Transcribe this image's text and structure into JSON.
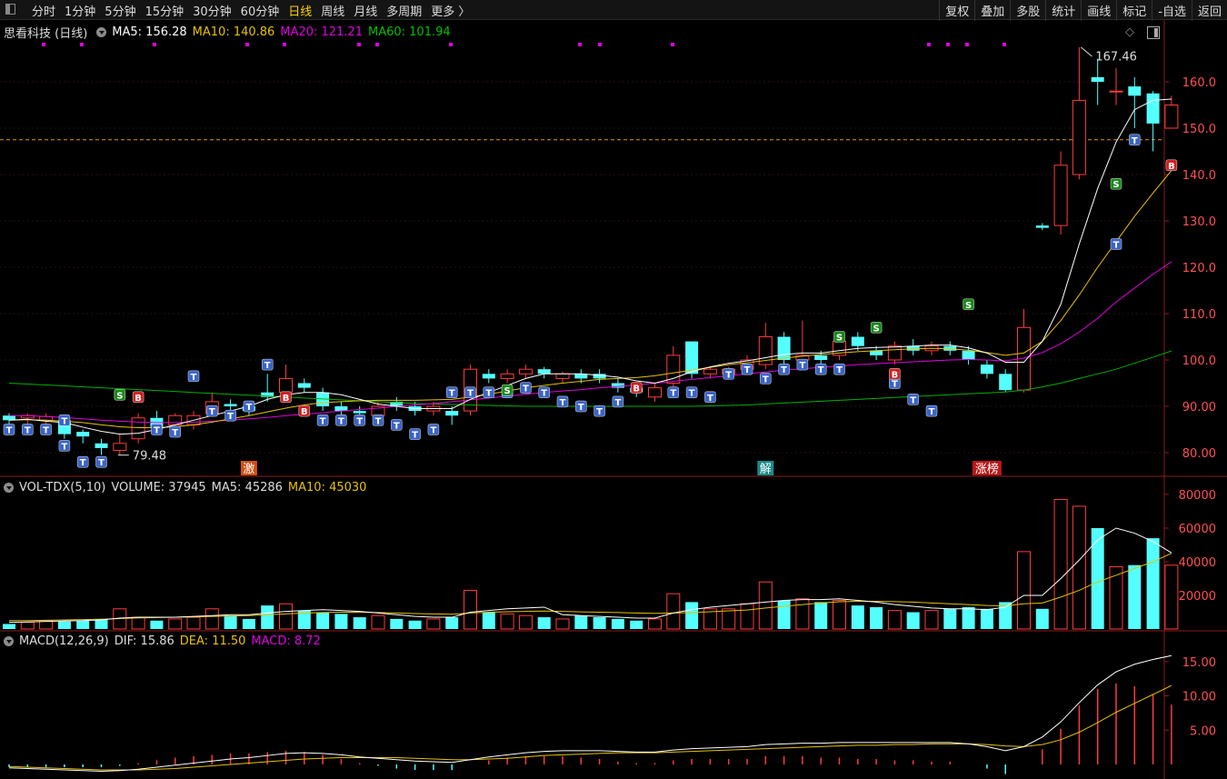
{
  "toolbar": {
    "periods": [
      "分时",
      "1分钟",
      "5分钟",
      "15分钟",
      "30分钟",
      "60分钟",
      "日线",
      "周线",
      "月线",
      "多周期",
      "更多 〉"
    ],
    "active_period": "日线",
    "tools": [
      "复权",
      "叠加",
      "多股",
      "统计",
      "画线",
      "标记",
      "-自选",
      "返回"
    ]
  },
  "price_panel": {
    "title": "思看科技 (日线)",
    "ma5": "MA5: 156.28",
    "ma10": "MA10: 140.86",
    "ma20": "MA20: 121.21",
    "ma60": "MA60: 101.94",
    "colors": {
      "ma5": "#ffffff",
      "ma10": "#e6c200",
      "ma20": "#e000e0",
      "ma60": "#00b000",
      "up": "#ff3b3b",
      "down": "#54ffff"
    },
    "high_label": "167.46",
    "low_label": "79.48",
    "current_price_line": 147.5,
    "event_labels": [
      "激",
      "解",
      "涨榜"
    ]
  },
  "volume_panel": {
    "name": "VOL-TDX(5,10)",
    "volume": "VOLUME: 37945",
    "ma5": "MA5: 45286",
    "ma10": "MA10: 45030",
    "ticks": [
      "80000",
      "60000",
      "40000",
      "20000"
    ]
  },
  "macd_panel": {
    "name": "MACD(12,26,9)",
    "dif": "DIF: 15.86",
    "dea": "DEA: 11.50",
    "macd": "MACD: 8.72",
    "ticks": [
      "15.00",
      "10.00",
      "5.00"
    ]
  },
  "chart_data": {
    "type": "candlestick",
    "price_ticks": [
      "160.0",
      "150.0",
      "140.0",
      "130.0",
      "120.0",
      "110.0",
      "100.0",
      "90.00",
      "80.00"
    ],
    "candles": [
      {
        "o": 88,
        "c": 87,
        "h": 88.5,
        "l": 86
      },
      {
        "o": 87.5,
        "c": 88,
        "h": 88.5,
        "l": 86
      },
      {
        "o": 87,
        "c": 87.8,
        "h": 88.5,
        "l": 86
      },
      {
        "o": 87,
        "c": 84,
        "h": 87.5,
        "l": 83
      },
      {
        "o": 84.5,
        "c": 83.5,
        "h": 85,
        "l": 82
      },
      {
        "o": 82,
        "c": 81,
        "h": 83,
        "l": 79.5
      },
      {
        "o": 80.5,
        "c": 82,
        "h": 84,
        "l": 79.48
      },
      {
        "o": 83,
        "c": 87.5,
        "h": 88.5,
        "l": 82
      },
      {
        "o": 87.5,
        "c": 85.5,
        "h": 89,
        "l": 84
      },
      {
        "o": 86,
        "c": 88,
        "h": 88.5,
        "l": 85
      },
      {
        "o": 86,
        "c": 88,
        "h": 89,
        "l": 85
      },
      {
        "o": 88.5,
        "c": 91,
        "h": 93,
        "l": 88
      },
      {
        "o": 90.5,
        "c": 90,
        "h": 91.5,
        "l": 89
      },
      {
        "o": 90,
        "c": 89,
        "h": 91,
        "l": 88
      },
      {
        "o": 93,
        "c": 92,
        "h": 97,
        "l": 91
      },
      {
        "o": 93,
        "c": 96,
        "h": 99,
        "l": 92
      },
      {
        "o": 95,
        "c": 94,
        "h": 96,
        "l": 93
      },
      {
        "o": 93,
        "c": 90,
        "h": 94,
        "l": 89
      },
      {
        "o": 90,
        "c": 89,
        "h": 91,
        "l": 88
      },
      {
        "o": 89,
        "c": 88.5,
        "h": 90,
        "l": 88
      },
      {
        "o": 88,
        "c": 90,
        "h": 91,
        "l": 87
      },
      {
        "o": 91,
        "c": 90,
        "h": 92,
        "l": 89
      },
      {
        "o": 90,
        "c": 89,
        "h": 91,
        "l": 88
      },
      {
        "o": 89,
        "c": 90,
        "h": 91,
        "l": 88
      },
      {
        "o": 89,
        "c": 88,
        "h": 90,
        "l": 86
      },
      {
        "o": 89,
        "c": 98,
        "h": 99,
        "l": 88
      },
      {
        "o": 97,
        "c": 96,
        "h": 98,
        "l": 95
      },
      {
        "o": 96,
        "c": 97,
        "h": 98,
        "l": 95
      },
      {
        "o": 97,
        "c": 98,
        "h": 99,
        "l": 96
      },
      {
        "o": 98,
        "c": 97,
        "h": 98.5,
        "l": 96
      },
      {
        "o": 96,
        "c": 97,
        "h": 97.5,
        "l": 95
      },
      {
        "o": 97,
        "c": 96,
        "h": 98,
        "l": 95
      },
      {
        "o": 97,
        "c": 96,
        "h": 98,
        "l": 95
      },
      {
        "o": 95,
        "c": 94,
        "h": 96,
        "l": 93
      },
      {
        "o": 94,
        "c": 93,
        "h": 95,
        "l": 92
      },
      {
        "o": 92,
        "c": 94,
        "h": 95,
        "l": 91
      },
      {
        "o": 95,
        "c": 101,
        "h": 103,
        "l": 94
      },
      {
        "o": 104,
        "c": 97,
        "h": 104,
        "l": 96
      },
      {
        "o": 97,
        "c": 98,
        "h": 98.5,
        "l": 96
      },
      {
        "o": 97,
        "c": 98,
        "h": 98.5,
        "l": 96
      },
      {
        "o": 98,
        "c": 100,
        "h": 101,
        "l": 97
      },
      {
        "o": 99,
        "c": 105,
        "h": 108,
        "l": 98
      },
      {
        "o": 105,
        "c": 100,
        "h": 106,
        "l": 99
      },
      {
        "o": 100,
        "c": 101,
        "h": 108.5,
        "l": 99
      },
      {
        "o": 101,
        "c": 100,
        "h": 102,
        "l": 99
      },
      {
        "o": 101,
        "c": 104,
        "h": 105,
        "l": 100
      },
      {
        "o": 105,
        "c": 103,
        "h": 106,
        "l": 102
      },
      {
        "o": 102,
        "c": 101,
        "h": 103,
        "l": 100
      },
      {
        "o": 100,
        "c": 103,
        "h": 104,
        "l": 99
      },
      {
        "o": 103,
        "c": 102,
        "h": 104.5,
        "l": 101
      },
      {
        "o": 102,
        "c": 103,
        "h": 104,
        "l": 101
      },
      {
        "o": 103,
        "c": 102,
        "h": 104,
        "l": 101
      },
      {
        "o": 102,
        "c": 100,
        "h": 103,
        "l": 99
      },
      {
        "o": 99,
        "c": 97,
        "h": 100,
        "l": 96
      },
      {
        "o": 97,
        "c": 93.5,
        "h": 98,
        "l": 93
      },
      {
        "o": 93.5,
        "c": 107,
        "h": 111,
        "l": 93
      },
      {
        "o": 129,
        "c": 128.5,
        "h": 129.5,
        "l": 128
      },
      {
        "o": 129,
        "c": 142,
        "h": 145,
        "l": 127
      },
      {
        "o": 140,
        "c": 156,
        "h": 167.46,
        "l": 139
      },
      {
        "o": 161,
        "c": 160,
        "h": 165,
        "l": 155
      },
      {
        "o": 158,
        "c": 158,
        "h": 163,
        "l": 155
      },
      {
        "o": 159,
        "c": 157,
        "h": 161,
        "l": 150
      },
      {
        "o": 157.5,
        "c": 151,
        "h": 158,
        "l": 145
      },
      {
        "o": 150,
        "c": 155,
        "h": 157,
        "l": 150
      }
    ],
    "ma5": [
      87,
      87.2,
      86.8,
      86.5,
      85.5,
      84.6,
      84,
      84.2,
      85,
      86,
      87,
      88,
      89,
      90,
      91.5,
      92.5,
      93,
      93,
      92.5,
      91.5,
      90.5,
      90,
      89.5,
      89.5,
      89.5,
      91.5,
      93,
      94.5,
      96,
      97,
      97,
      97,
      96.7,
      96.3,
      95.5,
      95,
      96,
      97.5,
      98.5,
      99.3,
      99.8,
      100.5,
      101.2,
      101.5,
      101.5,
      102,
      102.5,
      102.7,
      102.8,
      103,
      103.2,
      103.2,
      102.6,
      101.5,
      99.5,
      99.5,
      104,
      112,
      125,
      137,
      147,
      154,
      156,
      156.28
    ],
    "ma10": [
      87,
      87.1,
      87,
      86.8,
      86.5,
      86,
      85.6,
      85.4,
      85.4,
      85.6,
      86,
      86.6,
      87.3,
      88,
      88.8,
      89.6,
      90.3,
      90.8,
      91,
      91.2,
      91.3,
      91.3,
      91.3,
      91.4,
      91.5,
      92,
      92.6,
      93.3,
      94,
      94.5,
      95,
      95.4,
      95.8,
      96,
      96.2,
      96.6,
      97.2,
      97.8,
      98.4,
      99,
      99.4,
      99.9,
      100.4,
      100.8,
      101.2,
      101.5,
      101.8,
      102,
      102.2,
      102.4,
      102.5,
      102.4,
      102.1,
      101.6,
      101,
      101.5,
      104,
      108.5,
      114,
      120,
      125.5,
      131,
      136,
      140.86
    ],
    "ma20": [
      88,
      88,
      87.8,
      87.6,
      87.3,
      87,
      86.8,
      86.6,
      86.5,
      86.5,
      86.6,
      86.8,
      87,
      87.3,
      87.6,
      88,
      88.3,
      88.6,
      89,
      89.3,
      89.6,
      90,
      90.3,
      90.6,
      91,
      91.4,
      91.8,
      92.2,
      92.6,
      93,
      93.3,
      93.6,
      94,
      94.3,
      94.6,
      95,
      95.4,
      95.8,
      96.2,
      96.6,
      97,
      97.4,
      97.8,
      98.1,
      98.4,
      98.7,
      99,
      99.2,
      99.4,
      99.6,
      99.8,
      100,
      100.1,
      100,
      99.8,
      100.4,
      101.6,
      103.5,
      106,
      109,
      112.5,
      115.5,
      118.5,
      121.21
    ],
    "ma60": [
      95,
      94.8,
      94.6,
      94.4,
      94.2,
      94,
      93.8,
      93.6,
      93.4,
      93.2,
      93,
      92.8,
      92.6,
      92.4,
      92.2,
      92,
      91.8,
      91.6,
      91.4,
      91.2,
      91,
      90.8,
      90.6,
      90.5,
      90.4,
      90.3,
      90.2,
      90.1,
      90,
      90,
      90,
      90,
      90,
      90,
      90,
      90,
      90,
      90,
      90.1,
      90.2,
      90.3,
      90.5,
      90.7,
      90.9,
      91.1,
      91.3,
      91.5,
      91.7,
      91.9,
      92.1,
      92.3,
      92.5,
      92.7,
      92.9,
      93.1,
      93.5,
      94.2,
      95,
      96,
      97,
      98,
      99.3,
      100.6,
      101.94
    ],
    "volume": [
      3000,
      4000,
      5000,
      4500,
      5000,
      6000,
      12000,
      7000,
      5000,
      6000,
      7000,
      12000,
      8000,
      6000,
      14000,
      15000,
      11000,
      10000,
      9000,
      7000,
      8000,
      6000,
      5000,
      6000,
      7000,
      23000,
      10000,
      9000,
      8000,
      7000,
      6000,
      8000,
      7000,
      6000,
      5000,
      6000,
      21000,
      16000,
      12000,
      12000,
      15000,
      28000,
      17000,
      18000,
      16000,
      17000,
      14000,
      13000,
      11000,
      10000,
      11000,
      12000,
      13000,
      12000,
      16000,
      46000,
      12000,
      77000,
      73000,
      60000,
      37000,
      38000,
      54000,
      37945
    ],
    "vol_ma5": [
      4000,
      4200,
      4500,
      4800,
      5000,
      5500,
      6500,
      7000,
      7000,
      7000,
      7500,
      8000,
      8500,
      8500,
      9500,
      10500,
      11000,
      11500,
      11000,
      10500,
      9500,
      8500,
      7500,
      7000,
      7000,
      10000,
      11000,
      12000,
      12500,
      13000,
      8500,
      8000,
      7500,
      7000,
      6500,
      6500,
      9500,
      11500,
      13000,
      14000,
      15000,
      16000,
      17000,
      17500,
      17500,
      18000,
      17000,
      16000,
      14500,
      13500,
      12500,
      12000,
      12000,
      11500,
      13000,
      20000,
      20000,
      30000,
      41000,
      53000,
      60000,
      57000,
      52000,
      45286
    ],
    "vol_ma10": [
      5000,
      5000,
      5200,
      5400,
      5600,
      5800,
      6200,
      6600,
      6800,
      7000,
      7200,
      7500,
      7800,
      8000,
      8500,
      9000,
      9500,
      9800,
      10000,
      10000,
      9800,
      9500,
      9200,
      9000,
      8800,
      9500,
      10000,
      10300,
      10500,
      10700,
      10500,
      10200,
      10000,
      9800,
      9500,
      9300,
      9500,
      9800,
      10300,
      10800,
      11300,
      12500,
      13500,
      14500,
      15500,
      16200,
      16500,
      16500,
      16300,
      16000,
      15500,
      15000,
      14500,
      14000,
      13800,
      15000,
      15500,
      19000,
      23000,
      28000,
      32000,
      36000,
      40000,
      45030
    ],
    "dif": [
      -0.5,
      -0.6,
      -0.7,
      -0.8,
      -0.9,
      -1,
      -0.9,
      -0.7,
      -0.4,
      -0.1,
      0.2,
      0.5,
      0.8,
      1,
      1.3,
      1.6,
      1.7,
      1.6,
      1.4,
      1.1,
      0.9,
      0.7,
      0.5,
      0.4,
      0.3,
      0.7,
      1.1,
      1.4,
      1.7,
      1.9,
      2,
      2,
      2,
      1.9,
      1.8,
      1.8,
      2.1,
      2.3,
      2.4,
      2.5,
      2.6,
      2.9,
      3,
      3.1,
      3.1,
      3.2,
      3.2,
      3.2,
      3.2,
      3.2,
      3.2,
      3.2,
      3,
      2.6,
      2,
      2.6,
      4,
      6.2,
      9,
      11.6,
      13.5,
      14.6,
      15.3,
      15.86
    ],
    "dea": [
      -0.3,
      -0.4,
      -0.5,
      -0.6,
      -0.7,
      -0.8,
      -0.8,
      -0.8,
      -0.7,
      -0.6,
      -0.4,
      -0.2,
      0,
      0.2,
      0.4,
      0.6,
      0.8,
      0.9,
      1,
      1,
      1,
      1,
      0.9,
      0.8,
      0.7,
      0.7,
      0.8,
      0.9,
      1.1,
      1.3,
      1.4,
      1.5,
      1.6,
      1.7,
      1.7,
      1.7,
      1.8,
      1.9,
      2,
      2.1,
      2.2,
      2.3,
      2.4,
      2.5,
      2.6,
      2.7,
      2.8,
      2.8,
      2.9,
      2.9,
      3,
      3,
      3,
      2.9,
      2.7,
      2.6,
      2.9,
      3.6,
      4.7,
      6.1,
      7.6,
      8.9,
      10.2,
      11.5
    ]
  }
}
